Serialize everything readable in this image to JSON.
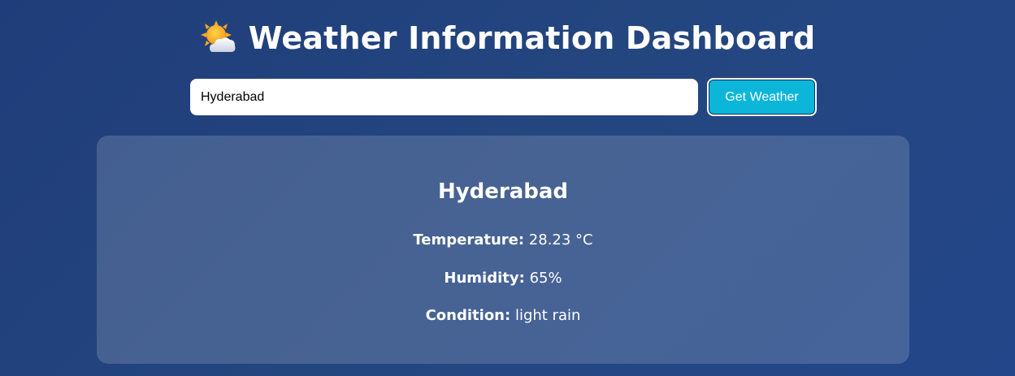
{
  "header": {
    "icon": "sun-behind-cloud-icon",
    "title": "Weather Information Dashboard"
  },
  "search": {
    "value": "Hyderabad",
    "button_label": "Get Weather"
  },
  "result": {
    "city": "Hyderabad",
    "temperature_label": "Temperature:",
    "temperature_value": "28.23 °C",
    "humidity_label": "Humidity:",
    "humidity_value": "65%",
    "condition_label": "Condition:",
    "condition_value": "light rain"
  },
  "colors": {
    "background": "#24457f",
    "button": "#0bb6d9",
    "card": "#4a6699",
    "text": "#ffffff"
  }
}
